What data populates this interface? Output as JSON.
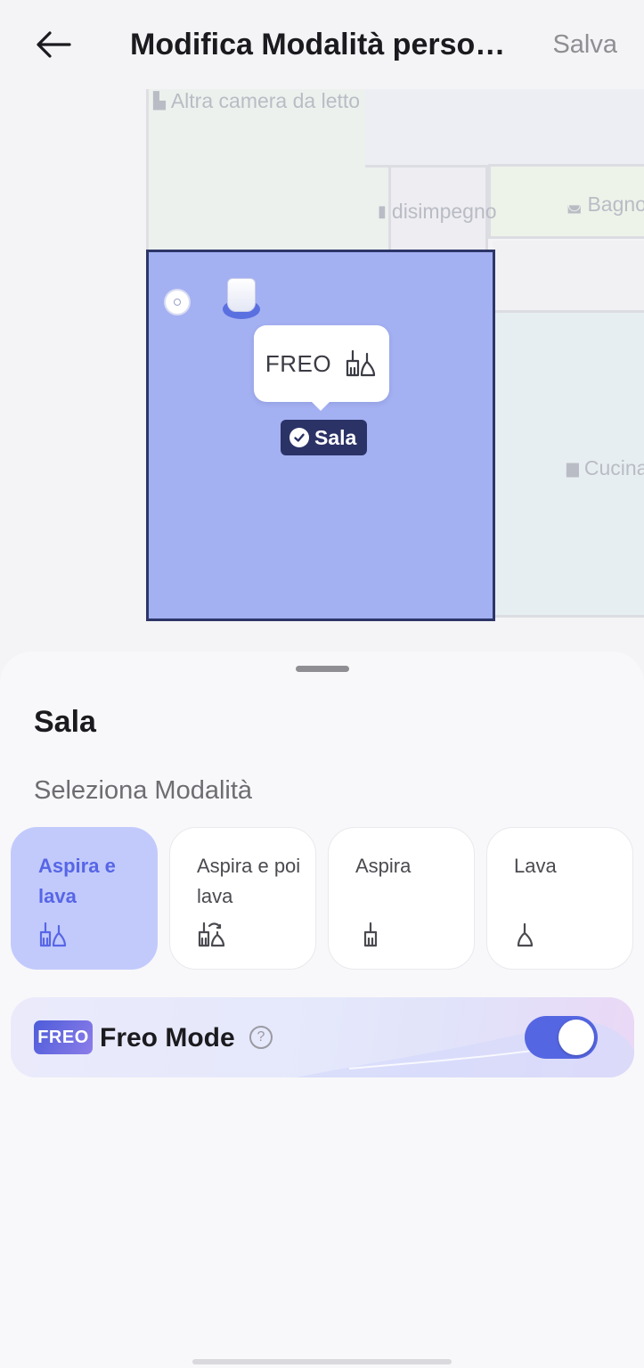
{
  "header": {
    "title": "Modifica Modalità personalizzata",
    "save_label": "Salva"
  },
  "map": {
    "rooms": {
      "bedroom": "Altra camera da letto",
      "hallway": "disimpegno",
      "bathroom": "Bagno",
      "kitchen": "Cucina"
    },
    "bubble_freo_label": "FREO",
    "selected_room_tag": "Sala"
  },
  "sheet": {
    "room_name": "Sala",
    "section_label": "Seleziona Modalità",
    "modes": [
      {
        "label": "Aspira e lava",
        "icon": "vacuum-and-mop-icon",
        "selected": true
      },
      {
        "label": "Aspira e poi lava",
        "icon": "vacuum-then-mop-icon",
        "selected": false
      },
      {
        "label": "Aspira",
        "icon": "vacuum-icon",
        "selected": false
      },
      {
        "label": "Lava",
        "icon": "mop-icon",
        "selected": false
      }
    ],
    "freo": {
      "badge": "FREO",
      "title": "Freo Mode",
      "help": "?",
      "enabled": true
    }
  },
  "colors": {
    "selected_room": "#a3b0f2",
    "accent": "#5566e2",
    "selected_card": "#c2cafc"
  }
}
